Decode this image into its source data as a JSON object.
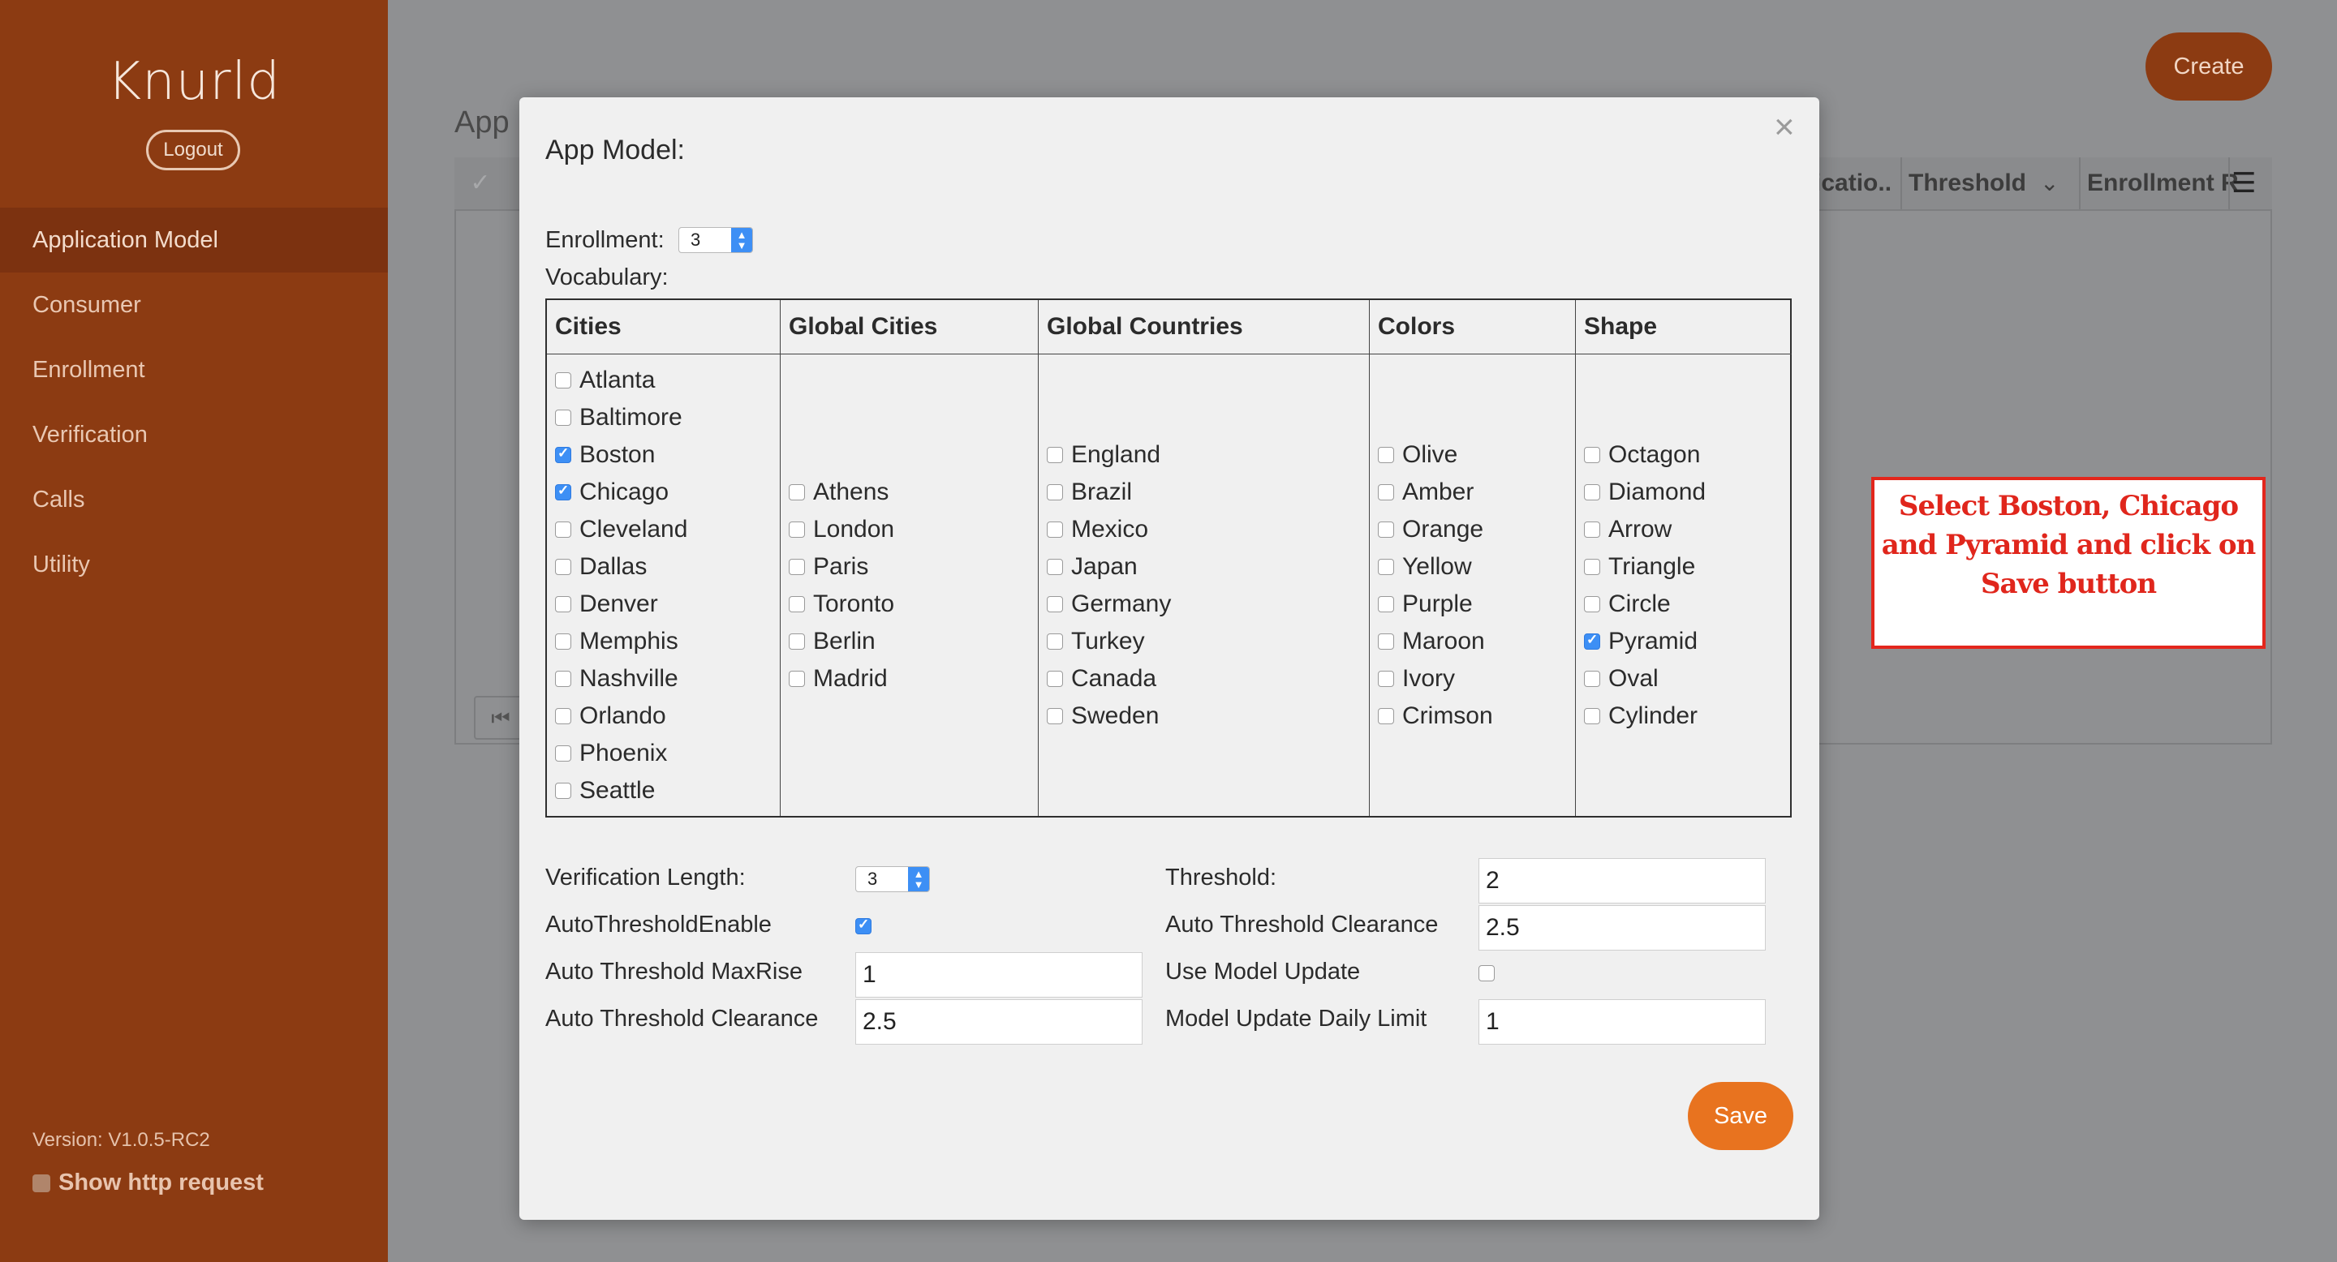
{
  "sidebar": {
    "brand": "Knurld",
    "logout_label": "Logout",
    "items": [
      {
        "label": "Application Model",
        "active": true
      },
      {
        "label": "Consumer"
      },
      {
        "label": "Enrollment"
      },
      {
        "label": "Verification"
      },
      {
        "label": "Calls"
      },
      {
        "label": "Utility"
      }
    ],
    "version": "Version: V1.0.5-RC2",
    "show_http_label": "Show http request"
  },
  "background": {
    "create_label": "Create",
    "page_title": "App",
    "columns": [
      "icatio..",
      "Threshold",
      "Enrollment R"
    ],
    "first_page_icon": "first-page-icon"
  },
  "modal": {
    "title": "App Model:",
    "close_icon": "×",
    "enrollment_label": "Enrollment:",
    "enrollment_value": "3",
    "vocabulary_label": "Vocabulary:",
    "vocabulary": {
      "cities": {
        "header": "Cities",
        "items": [
          {
            "label": "Atlanta",
            "checked": false
          },
          {
            "label": "Baltimore",
            "checked": false
          },
          {
            "label": "Boston",
            "checked": true
          },
          {
            "label": "Chicago",
            "checked": true
          },
          {
            "label": "Cleveland",
            "checked": false
          },
          {
            "label": "Dallas",
            "checked": false
          },
          {
            "label": "Denver",
            "checked": false
          },
          {
            "label": "Memphis",
            "checked": false
          },
          {
            "label": "Nashville",
            "checked": false
          },
          {
            "label": "Orlando",
            "checked": false
          },
          {
            "label": "Phoenix",
            "checked": false
          },
          {
            "label": "Seattle",
            "checked": false
          }
        ]
      },
      "global_cities": {
        "header": "Global Cities",
        "items": [
          {
            "label": "Athens",
            "checked": false
          },
          {
            "label": "London",
            "checked": false
          },
          {
            "label": "Paris",
            "checked": false
          },
          {
            "label": "Toronto",
            "checked": false
          },
          {
            "label": "Berlin",
            "checked": false
          },
          {
            "label": "Madrid",
            "checked": false
          }
        ]
      },
      "global_countries": {
        "header": "Global Countries",
        "items": [
          {
            "label": "England",
            "checked": false
          },
          {
            "label": "Brazil",
            "checked": false
          },
          {
            "label": "Mexico",
            "checked": false
          },
          {
            "label": "Japan",
            "checked": false
          },
          {
            "label": "Germany",
            "checked": false
          },
          {
            "label": "Turkey",
            "checked": false
          },
          {
            "label": "Canada",
            "checked": false
          },
          {
            "label": "Sweden",
            "checked": false
          }
        ]
      },
      "colors": {
        "header": "Colors",
        "items": [
          {
            "label": "Olive",
            "checked": false
          },
          {
            "label": "Amber",
            "checked": false
          },
          {
            "label": "Orange",
            "checked": false
          },
          {
            "label": "Yellow",
            "checked": false
          },
          {
            "label": "Purple",
            "checked": false
          },
          {
            "label": "Maroon",
            "checked": false
          },
          {
            "label": "Ivory",
            "checked": false
          },
          {
            "label": "Crimson",
            "checked": false
          }
        ]
      },
      "shape": {
        "header": "Shape",
        "items": [
          {
            "label": "Octagon",
            "checked": false
          },
          {
            "label": "Diamond",
            "checked": false
          },
          {
            "label": "Arrow",
            "checked": false
          },
          {
            "label": "Triangle",
            "checked": false
          },
          {
            "label": "Circle",
            "checked": false
          },
          {
            "label": "Pyramid",
            "checked": true
          },
          {
            "label": "Oval",
            "checked": false
          },
          {
            "label": "Cylinder",
            "checked": false
          }
        ]
      }
    },
    "verification_length_label": "Verification Length:",
    "verification_length_value": "3",
    "auto_threshold_enable_label": "AutoThresholdEnable",
    "auto_threshold_enable": true,
    "auto_threshold_maxrise_label": "Auto Threshold MaxRise",
    "auto_threshold_maxrise_value": "1",
    "auto_threshold_clearance_label": "Auto Threshold Clearance",
    "auto_threshold_clearance_value": "2.5",
    "threshold_label": "Threshold:",
    "threshold_value": "2",
    "auto_threshold_clearance_right_label": "Auto Threshold Clearance",
    "auto_threshold_clearance_right_value": "2.5",
    "use_model_update_label": "Use Model Update",
    "use_model_update": false,
    "model_update_daily_limit_label": "Model Update Daily Limit",
    "model_update_daily_limit_value": "1",
    "save_label": "Save"
  },
  "annotation": {
    "text": "Select Boston, Chicago and Pyramid and click on Save button",
    "color": "#e3261c"
  },
  "colors": {
    "sidebar": "#8c3b12",
    "accent": "#e8731f",
    "checkbox_checked": "#3d8ff5"
  }
}
